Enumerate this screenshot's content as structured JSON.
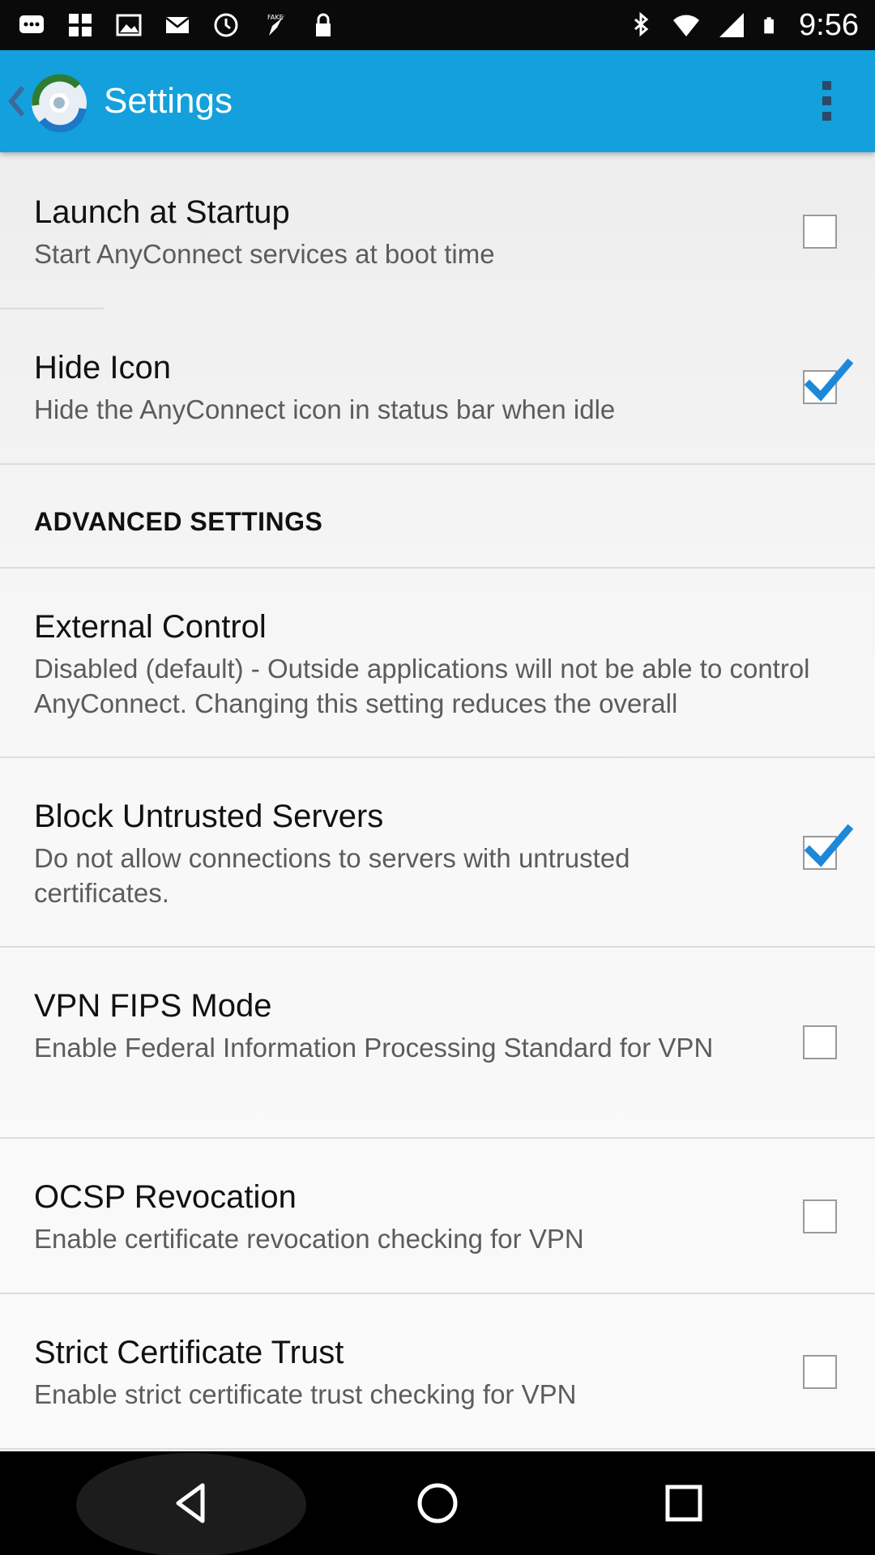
{
  "status_bar": {
    "time": "9:56",
    "left_icons": [
      "message-icon",
      "grid-icon",
      "image-icon",
      "mail-icon",
      "alarm-icon",
      "fake-gps-icon",
      "lock-icon"
    ],
    "right_icons": [
      "bluetooth-icon",
      "wifi-icon",
      "signal-icon",
      "battery-icon"
    ]
  },
  "app_bar": {
    "title": "Settings",
    "back_icon": "chevron-left-icon",
    "logo_icon": "anyconnect-logo-icon",
    "menu_icon": "overflow-menu-icon",
    "color": "#13a0dc"
  },
  "preferences": [
    {
      "title": "Launch at Startup",
      "summary": "Start AnyConnect services at boot time",
      "checked": false
    },
    {
      "title": "Hide Icon",
      "summary": "Hide the AnyConnect icon in status bar when idle",
      "checked": true
    }
  ],
  "advanced_section": {
    "header": "ADVANCED SETTINGS",
    "items": [
      {
        "title": "External Control",
        "summary": "Disabled (default) - Outside applications will not be able to control AnyConnect. Changing this setting reduces the overall"
      },
      {
        "title": "Block Untrusted Servers",
        "summary": "Do not allow connections to servers with untrusted certificates.",
        "checked": true
      },
      {
        "title": "VPN FIPS Mode",
        "summary": "Enable Federal Information Processing Standard for VPN",
        "checked": false
      },
      {
        "title": "OCSP Revocation",
        "summary": "Enable certificate revocation checking for VPN",
        "checked": false
      },
      {
        "title": "Strict Certificate Trust",
        "summary": "Enable strict certificate trust checking for VPN",
        "checked": false
      }
    ]
  },
  "nav_bar": {
    "icons": [
      "back-icon",
      "home-icon",
      "recents-icon"
    ]
  },
  "colors": {
    "accent_check": "#1e88d8",
    "app_bar": "#13a0dc"
  }
}
